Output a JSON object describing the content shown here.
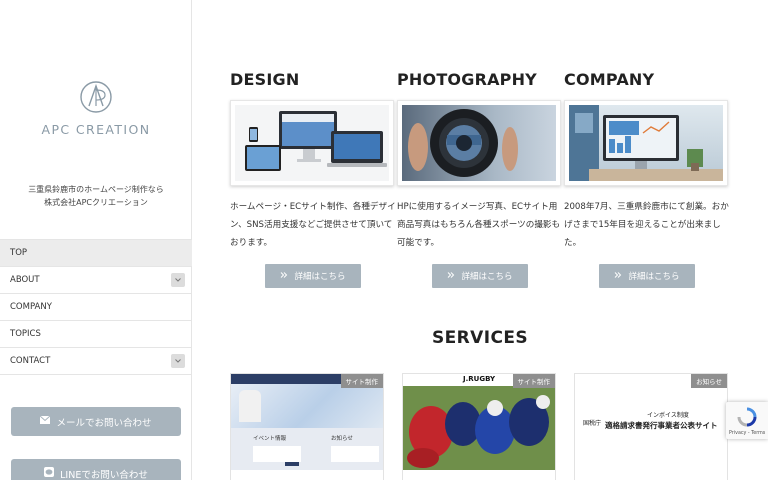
{
  "brand": {
    "name": "APC CREATION",
    "tagline_line1": "三重県鈴鹿市のホームページ制作なら",
    "tagline_line2": "株式会社APCクリエーション"
  },
  "nav": {
    "items": [
      {
        "label": "TOP",
        "active": true
      },
      {
        "label": "ABOUT",
        "has_submenu": true
      },
      {
        "label": "COMPANY"
      },
      {
        "label": "TOPICS"
      },
      {
        "label": "CONTACT",
        "has_submenu": true
      }
    ]
  },
  "side_buttons": {
    "mail_label": "メールでお問い合わせ",
    "line_label": "LINEでお問い合わせ"
  },
  "columns": [
    {
      "title": "DESIGN",
      "text": "ホームページ・ECサイト制作、各種デザイン、SNS活用支援などご提供させて頂いております。",
      "button": "詳細はこちら"
    },
    {
      "title": "PHOTOGRAPHY",
      "text": "HPに使用するイメージ写真、ECサイト用商品写真はもちろん各種スポーツの撮影も可能です。",
      "button": "詳細はこちら"
    },
    {
      "title": "COMPANY",
      "text": "2008年7月、三重県鈴鹿市にて創業。おかげさまで15年目を迎えることが出来ました。",
      "button": "詳細はこちら"
    }
  ],
  "services": {
    "title": "SERVICES",
    "cards": [
      {
        "badge": "サイト制作",
        "thumb_heading": "イベント情報",
        "thumb_heading2": "お知らせ"
      },
      {
        "badge": "サイト制作",
        "thumb_logo": "J.RUGBY"
      },
      {
        "badge": "お知らせ",
        "thumb_line1": "インボイス制度",
        "thumb_line2": "適格請求書発行事業者公表サイト",
        "thumb_label": "国税庁"
      }
    ]
  },
  "recaptcha": {
    "links": "Privacy - Terms"
  },
  "colors": {
    "button": "#a8b4bd",
    "logo": "#8a9aa6",
    "badge": "#8f8f8f"
  }
}
